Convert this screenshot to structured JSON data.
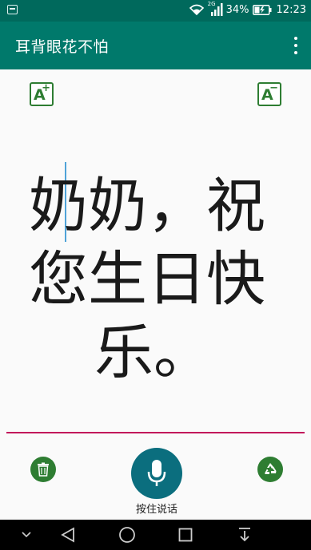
{
  "status_bar": {
    "network_label": "2G",
    "battery_percent": "34%",
    "time": "12:23"
  },
  "app_bar": {
    "title": "耳背眼花不怕"
  },
  "font_controls": {
    "increase_glyph": "A",
    "increase_sign": "+",
    "decrease_glyph": "A",
    "decrease_sign": "−"
  },
  "speech_text": {
    "line1": "奶奶，祝",
    "line2": "您生日快",
    "line3": "乐。"
  },
  "bottom_controls": {
    "mic_label": "按住说话"
  },
  "colors": {
    "status_bar": "#00695c",
    "app_bar": "#00796b",
    "accent_green": "#2e7d32",
    "mic_button": "#0b6e7e",
    "divider": "#c2185b"
  }
}
